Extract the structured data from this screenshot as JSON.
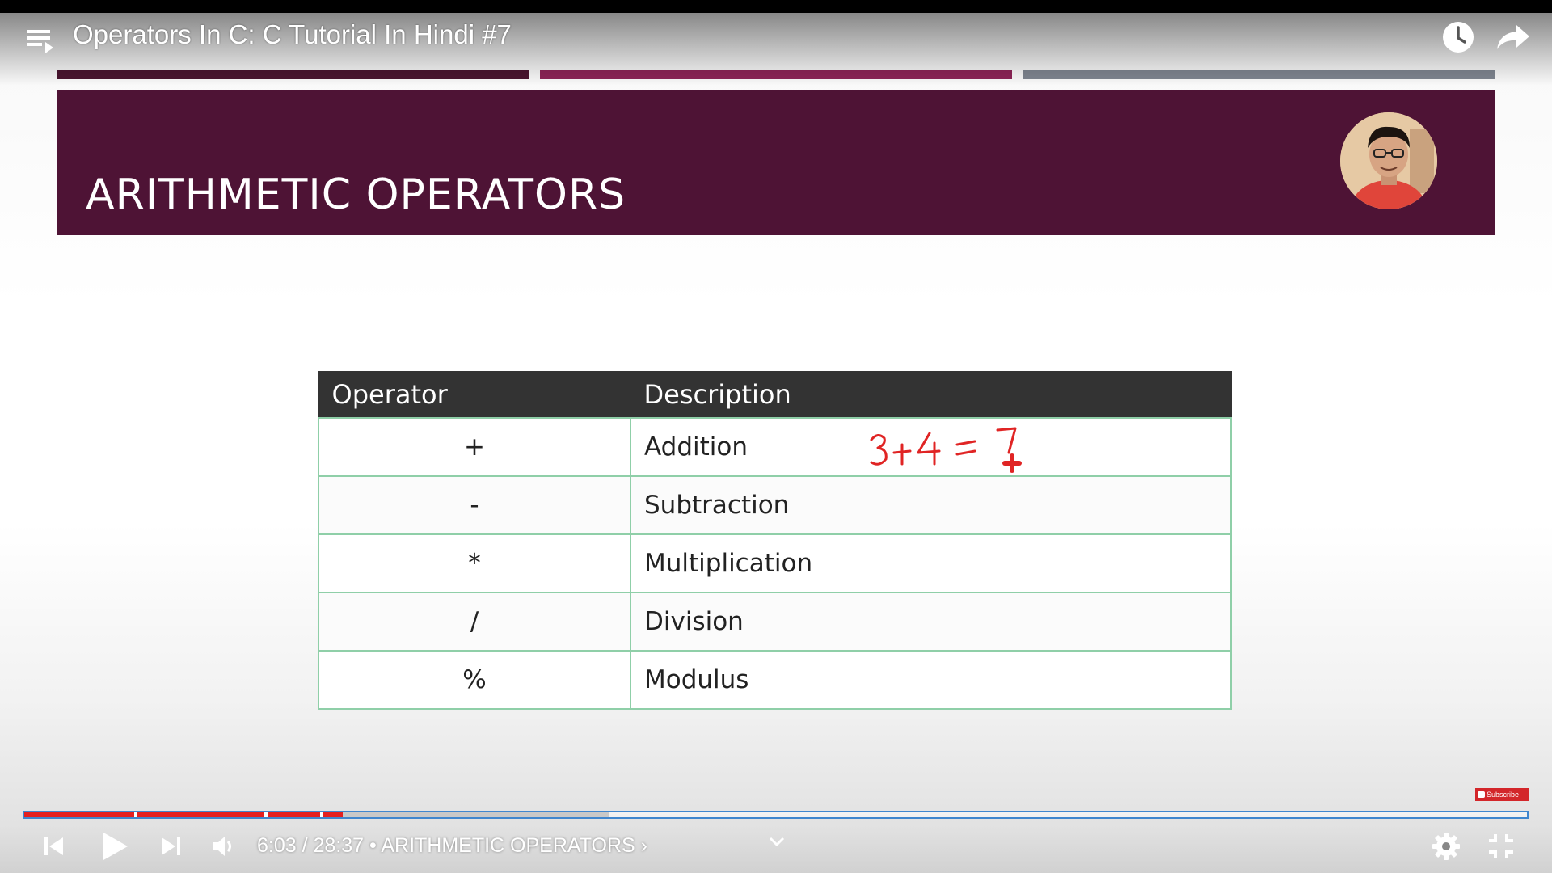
{
  "player": {
    "title": "Operators In C: C Tutorial In Hindi #7",
    "icons": {
      "playlist": "playlist-icon",
      "watch_later": "clock-icon",
      "share": "share-arrow-icon"
    }
  },
  "slide": {
    "title": "ARITHMETIC OPERATORS",
    "accent_colors": [
      "#4a1530",
      "#8d2457",
      "#7f8590"
    ],
    "header_color": "#4e1335",
    "table": {
      "headers": [
        "Operator",
        "Description"
      ],
      "rows": [
        {
          "operator": "+",
          "description": "Addition"
        },
        {
          "operator": "-",
          "description": "Subtraction"
        },
        {
          "operator": "*",
          "description": "Multiplication"
        },
        {
          "operator": "/",
          "description": "Division"
        },
        {
          "operator": "%",
          "description": "Modulus"
        }
      ]
    },
    "annotation": "3+4=7"
  },
  "watermark": {
    "subscribe_label": "Subscribe"
  },
  "controls": {
    "current_time": "6:03",
    "duration": "28:37",
    "separator": " / ",
    "bullet": " • ",
    "chapter": "ARITHMETIC OPERATORS ›",
    "progress_played": 0.212,
    "progress_buffered": 0.389,
    "played_color": "#e32020",
    "icons": {
      "previous": "skip-previous-icon",
      "play": "play-icon",
      "next": "skip-next-icon",
      "volume": "volume-icon",
      "chapters": "chevron-down-icon",
      "settings": "gear-icon",
      "fullscreen": "exit-fullscreen-icon"
    }
  }
}
